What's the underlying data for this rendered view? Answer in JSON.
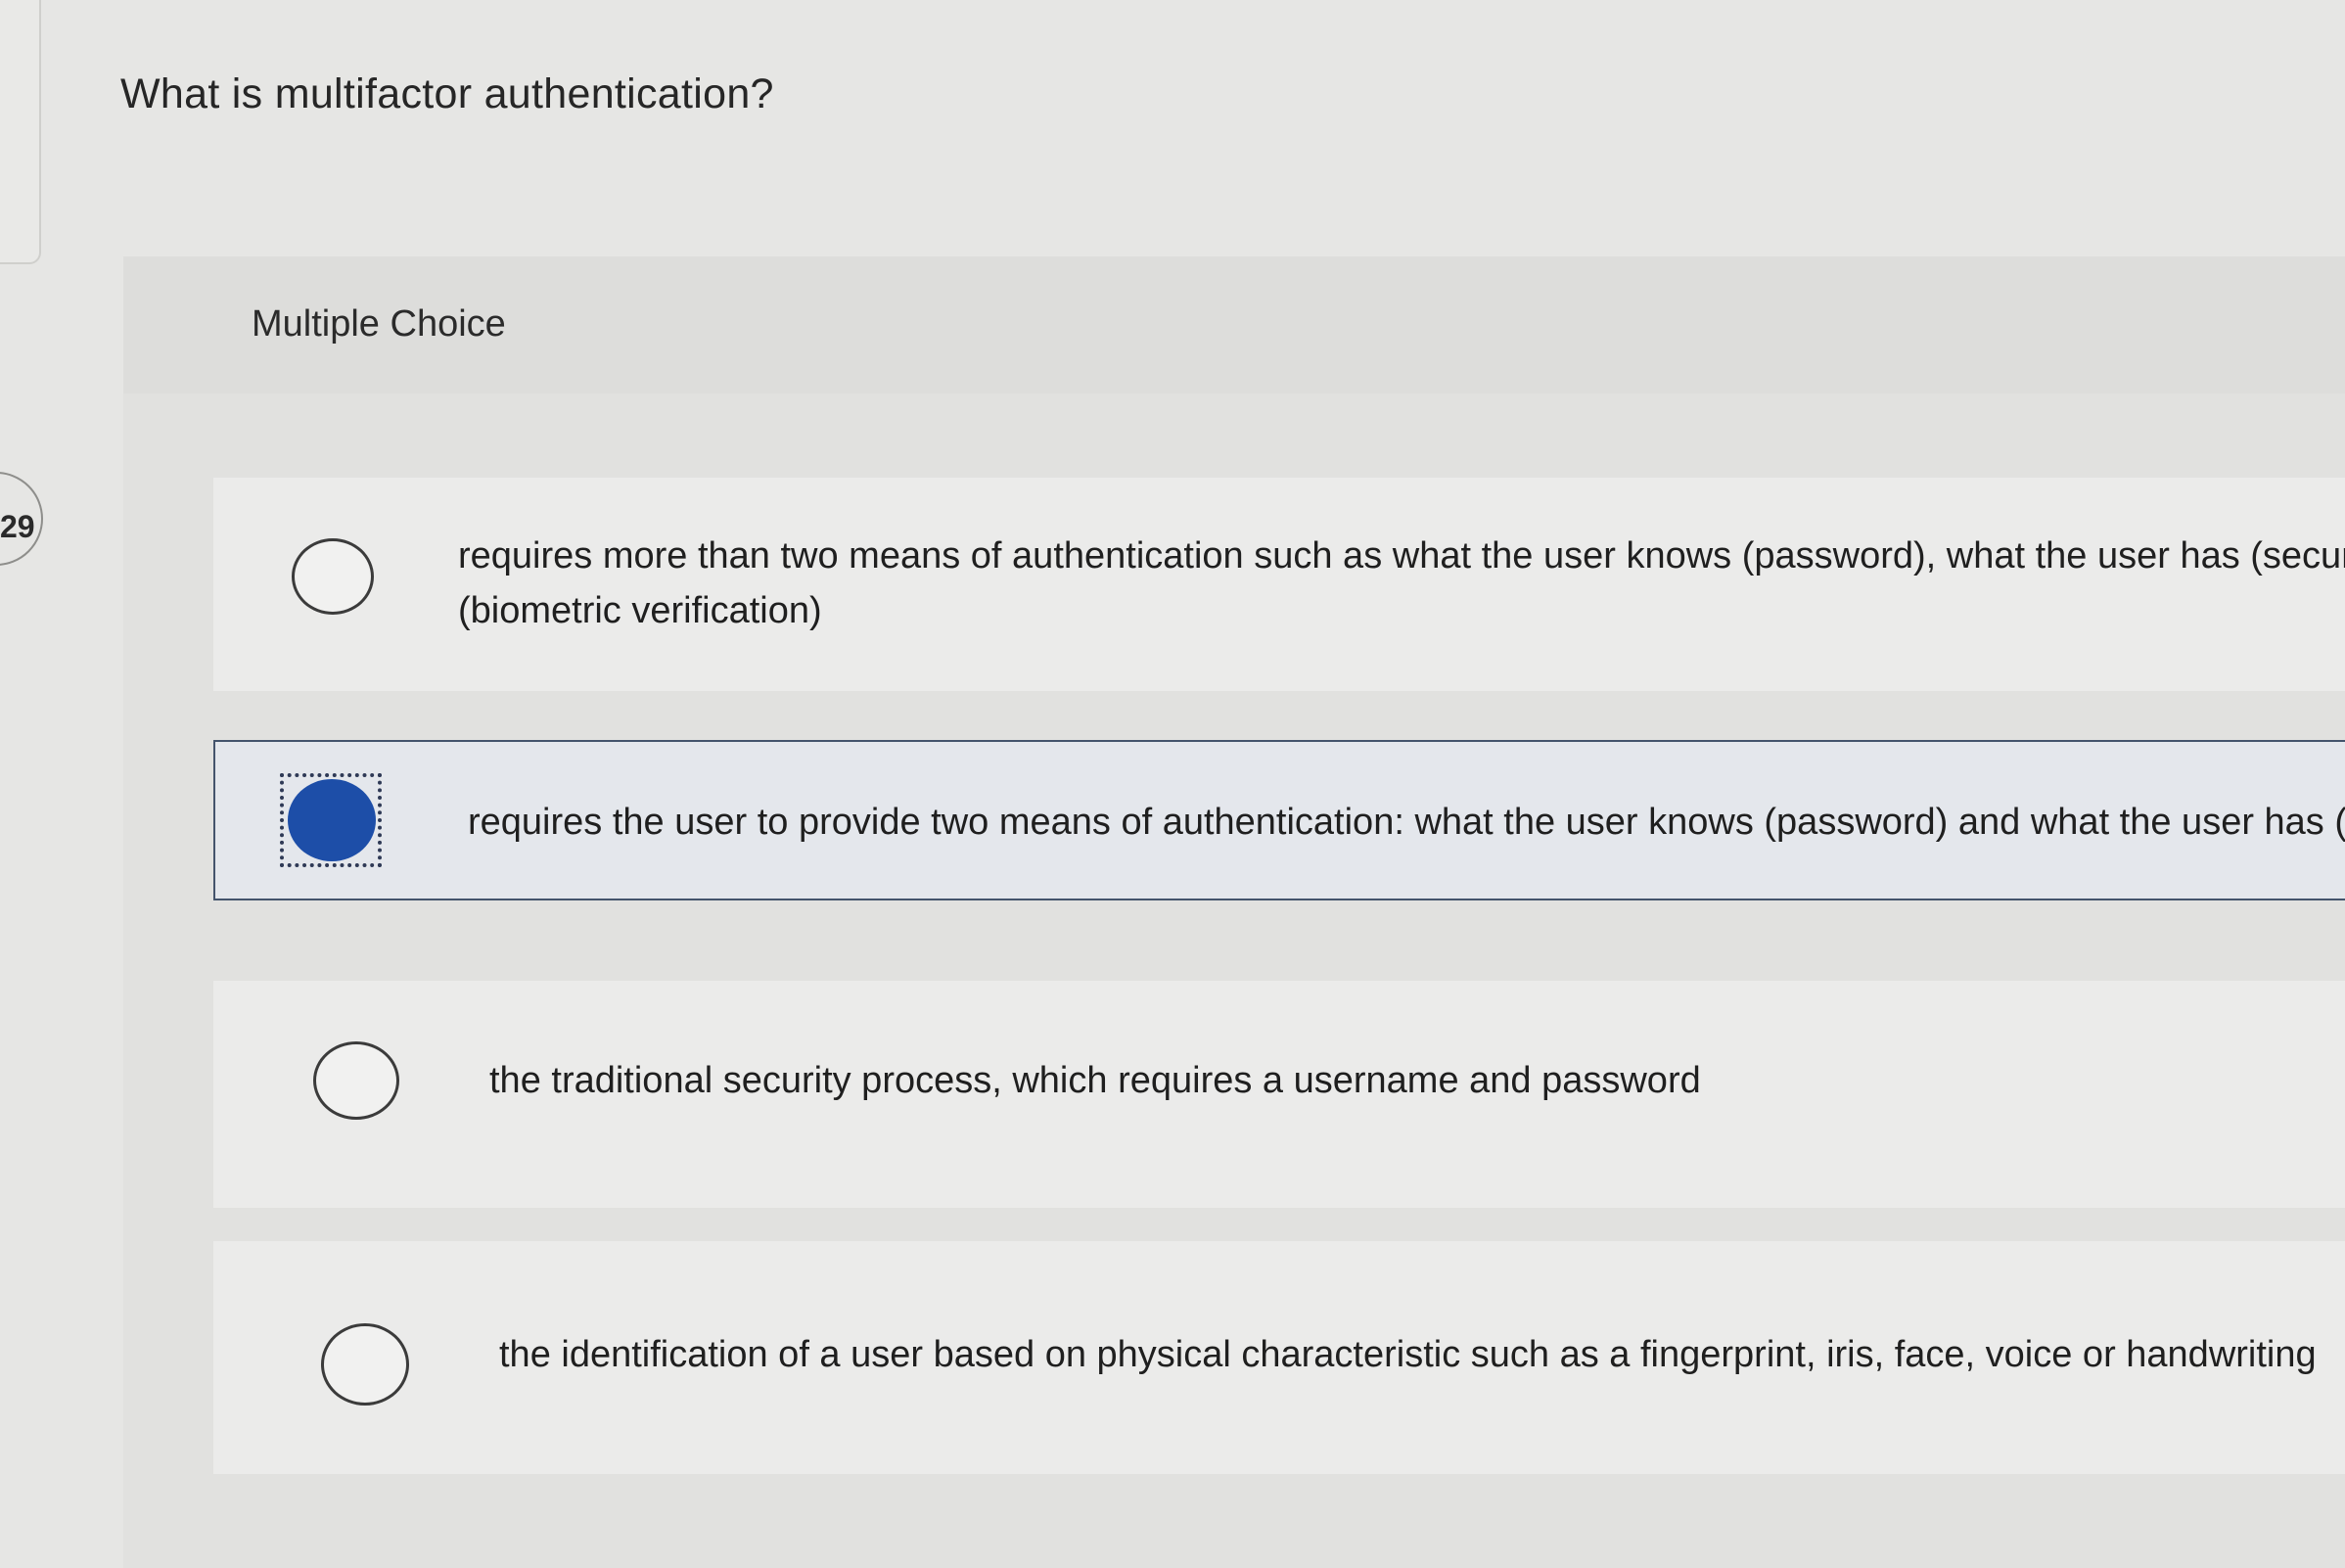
{
  "question": {
    "number": "29",
    "title": "What is multifactor authentication?"
  },
  "panel": {
    "header": "Multiple Choice"
  },
  "options": [
    {
      "label": "requires more than two means of authentication such as what the user knows (password), what the user has (security tok (biometric verification)",
      "selected": false
    },
    {
      "label": "requires the user to provide two means of authentication: what the user knows (password) and what the user has (sec",
      "selected": true
    },
    {
      "label": "the traditional security process, which requires a username and password",
      "selected": false
    },
    {
      "label": "the identification of a user based on physical characteristic such as a fingerprint, iris, face, voice or handwriting",
      "selected": false
    }
  ],
  "colors": {
    "selected_radio": "#1d4ea8",
    "selected_border": "#44546c"
  }
}
